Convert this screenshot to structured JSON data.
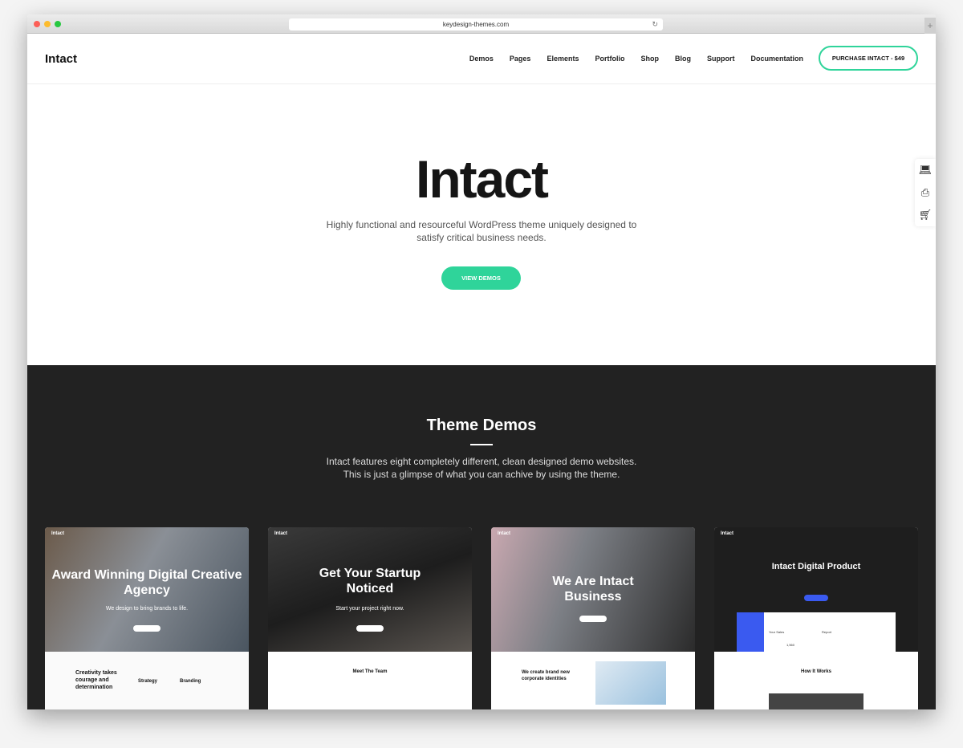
{
  "browser": {
    "url": "keydesign-themes.com",
    "reload_icon": "reload-icon",
    "new_tab_icon": "plus-icon"
  },
  "nav": {
    "logo": "Intact",
    "items": [
      "Demos",
      "Pages",
      "Elements",
      "Portfolio",
      "Shop",
      "Blog",
      "Support",
      "Documentation"
    ],
    "cta": "PURCHASE INTACT - $49"
  },
  "hero": {
    "title": "Intact",
    "subtitle": "Highly functional and resourceful WordPress theme uniquely designed to satisfy critical business needs.",
    "button": "VIEW DEMOS"
  },
  "side_icons": [
    "laptop-icon",
    "printer-icon",
    "cart-icon"
  ],
  "demos": {
    "title": "Theme Demos",
    "subtitle": "Intact features eight completely different, clean designed demo websites. This is just a glimpse of what you can achive by using the theme.",
    "cards": [
      {
        "logo": "Intact",
        "headline": "Award Winning Digital Creative Agency",
        "tagline": "We design to bring brands to life.",
        "lower_title": "Creativity takes courage and determination",
        "features": [
          "Strategy",
          "Branding"
        ],
        "accent": "#2fd49a"
      },
      {
        "logo": "Intact",
        "headline": "Get Your Startup Noticed",
        "tagline": "Start your project right now.",
        "lower_title": "Meet The Team",
        "accent": "#e0245e"
      },
      {
        "logo": "Intact",
        "headline": "We Are Intact Business",
        "tagline": "",
        "lower_title": "We create brand new corporate identities",
        "accent": "#3a5af0"
      },
      {
        "logo": "Intact",
        "headline": "Intact Digital Product",
        "tagline": "",
        "lower_title": "How It Works",
        "dashboard": {
          "sales_label": "Your Sales",
          "sales_value": "1,560",
          "report_label": "Report"
        },
        "accent": "#3a5af0"
      }
    ]
  },
  "colors": {
    "accent": "#2fd49a",
    "dark_bg": "#222222"
  }
}
